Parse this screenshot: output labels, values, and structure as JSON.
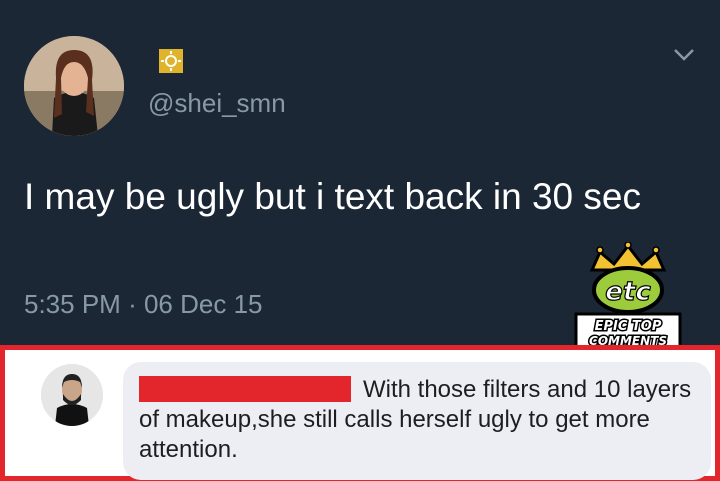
{
  "tweet": {
    "handle": "@shei_smn",
    "text": "I may be ugly but i text back in 30 sec",
    "time": "5:35 PM",
    "separator": "·",
    "date": "06 Dec 15"
  },
  "logo": {
    "brand": "etc",
    "tagline_line1": "EPIC TOP",
    "tagline_line2": "COMMENTS"
  },
  "comment": {
    "text": "With those filters and 10 layers of makeup,she still calls herself ugly to get more attention."
  },
  "colors": {
    "tweet_background": "#1c2735",
    "secondary_text": "#8899a6",
    "highlight_border": "#e3262b",
    "redaction": "#e3262b",
    "bubble": "#eceef3"
  },
  "icons": [
    "sun-icon",
    "chevron-down-icon",
    "crown-icon"
  ]
}
